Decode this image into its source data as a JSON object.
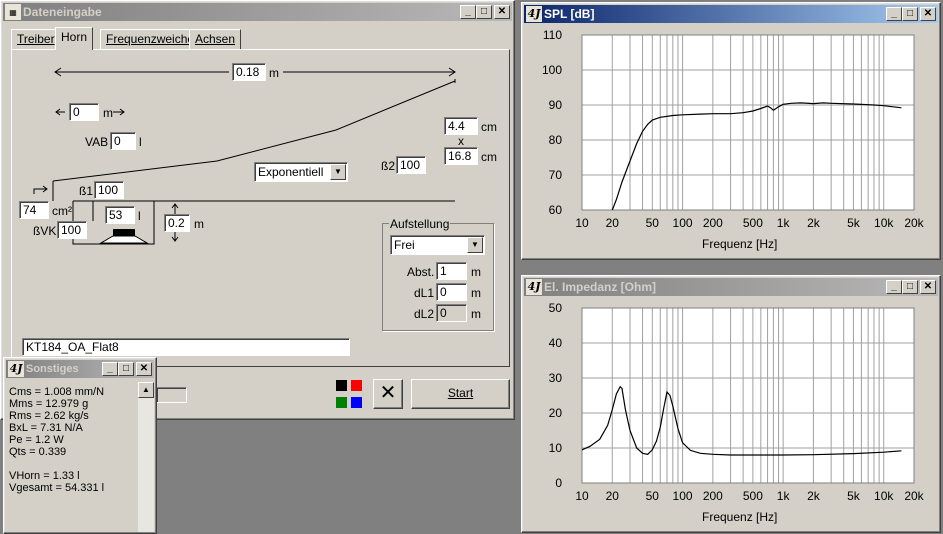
{
  "dateneingabe": {
    "title": "Dateneingabe",
    "tabs": [
      "Treiber",
      "Horn",
      "Frequenzweiche",
      "Achsen"
    ],
    "length_value": "0.18",
    "length_unit": "m",
    "offset_value": "0",
    "offset_unit": "m",
    "vab_label": "VAB",
    "vab_value": "0",
    "vab_unit": "l",
    "mouth_w": "4.4",
    "mouth_w_unit": "cm",
    "times": "x",
    "mouth_h": "16.8",
    "mouth_h_unit": "cm",
    "beta2_label": "ß2",
    "beta2_value": "100",
    "flare_type": "Exponentiell",
    "beta1_label": "ß1",
    "beta1_value": "100",
    "throat_area": "74",
    "throat_unit": "cm²",
    "betavk_label": "ßVK",
    "betavk_value": "100",
    "vol_value": "53",
    "vol_unit": "l",
    "depth_value": "0.2",
    "depth_unit": "m",
    "aufstellung_label": "Aufstellung",
    "aufstellung_value": "Frei",
    "abst_label": "Abst.",
    "abst_value": "1",
    "abst_unit": "m",
    "dl1_label": "dL1",
    "dl1_value": "0",
    "dl1_unit": "m",
    "dl2_label": "dL2",
    "dl2_value": "0",
    "dl2_unit": "m",
    "filename": "KT184_OA_Flat8",
    "start_label": "Start",
    "colors": [
      "#000000",
      "#ff0000",
      "#008000",
      "#0000ff"
    ]
  },
  "sonstiges": {
    "title": "Sonstiges",
    "lines": [
      "Cms = 1.008 mm/N",
      "Mms = 12.979 g",
      "Rms = 2.62 kg/s",
      "BxL = 7.31 N/A",
      "Pe = 1.2 W",
      "Qts = 0.339",
      "",
      "VHorn = 1.33 l",
      "Vgesamt = 54.331 l"
    ]
  },
  "spl_window": {
    "title": "SPL [dB]",
    "xlabel": "Frequenz [Hz]"
  },
  "imp_window": {
    "title": "El. Impedanz [Ohm]",
    "xlabel": "Frequenz [Hz]"
  },
  "chart_data": [
    {
      "type": "line",
      "title": "SPL [dB]",
      "xlabel": "Frequenz [Hz]",
      "ylabel": "",
      "x_scale": "log",
      "xlim": [
        10,
        20000
      ],
      "ylim": [
        60,
        110
      ],
      "x_ticks": [
        "10",
        "20",
        "50",
        "100",
        "200",
        "500",
        "1k",
        "2k",
        "5k",
        "10k",
        "20k"
      ],
      "y_ticks": [
        "110",
        "100",
        "90",
        "80",
        "70",
        "60"
      ],
      "grid": true,
      "series": [
        {
          "x": [
            20,
            22,
            25,
            30,
            35,
            40,
            45,
            50,
            60,
            80,
            100,
            150,
            200,
            300,
            400,
            500,
            600,
            700,
            750,
            800,
            900,
            1000,
            1200,
            1500,
            2000,
            2500,
            3000,
            5000,
            8000,
            10000,
            15000
          ],
          "y": [
            60,
            63,
            68,
            74,
            79,
            82.5,
            84.5,
            85.7,
            86.5,
            87,
            87.2,
            87.4,
            87.5,
            87.5,
            87.8,
            88.3,
            89,
            89.7,
            89.2,
            88.5,
            89.5,
            90.2,
            90.5,
            90.6,
            90.4,
            90.6,
            90.5,
            90.3,
            90.0,
            89.8,
            89.2
          ]
        }
      ]
    },
    {
      "type": "line",
      "title": "El. Impedanz [Ohm]",
      "xlabel": "Frequenz [Hz]",
      "ylabel": "",
      "x_scale": "log",
      "xlim": [
        10,
        20000
      ],
      "ylim": [
        0,
        50
      ],
      "x_ticks": [
        "10",
        "20",
        "50",
        "100",
        "200",
        "500",
        "1k",
        "2k",
        "5k",
        "10k",
        "20k"
      ],
      "y_ticks": [
        "50",
        "40",
        "30",
        "20",
        "10",
        "0"
      ],
      "grid": true,
      "series": [
        {
          "x": [
            10,
            12,
            15,
            18,
            20,
            22,
            24,
            25,
            27,
            30,
            35,
            40,
            45,
            50,
            55,
            60,
            65,
            70,
            75,
            80,
            90,
            100,
            120,
            150,
            200,
            300,
            500,
            1000,
            2000,
            5000,
            10000,
            15000
          ],
          "y": [
            9.5,
            10.5,
            12.5,
            16.5,
            21,
            25.5,
            27.5,
            27,
            21,
            15,
            10,
            8.5,
            8.2,
            9.5,
            12,
            16,
            21.5,
            26,
            25,
            22,
            15.5,
            11.5,
            9.3,
            8.5,
            8.2,
            8.0,
            8.0,
            8.0,
            8.1,
            8.4,
            8.8,
            9.2
          ]
        }
      ]
    }
  ]
}
